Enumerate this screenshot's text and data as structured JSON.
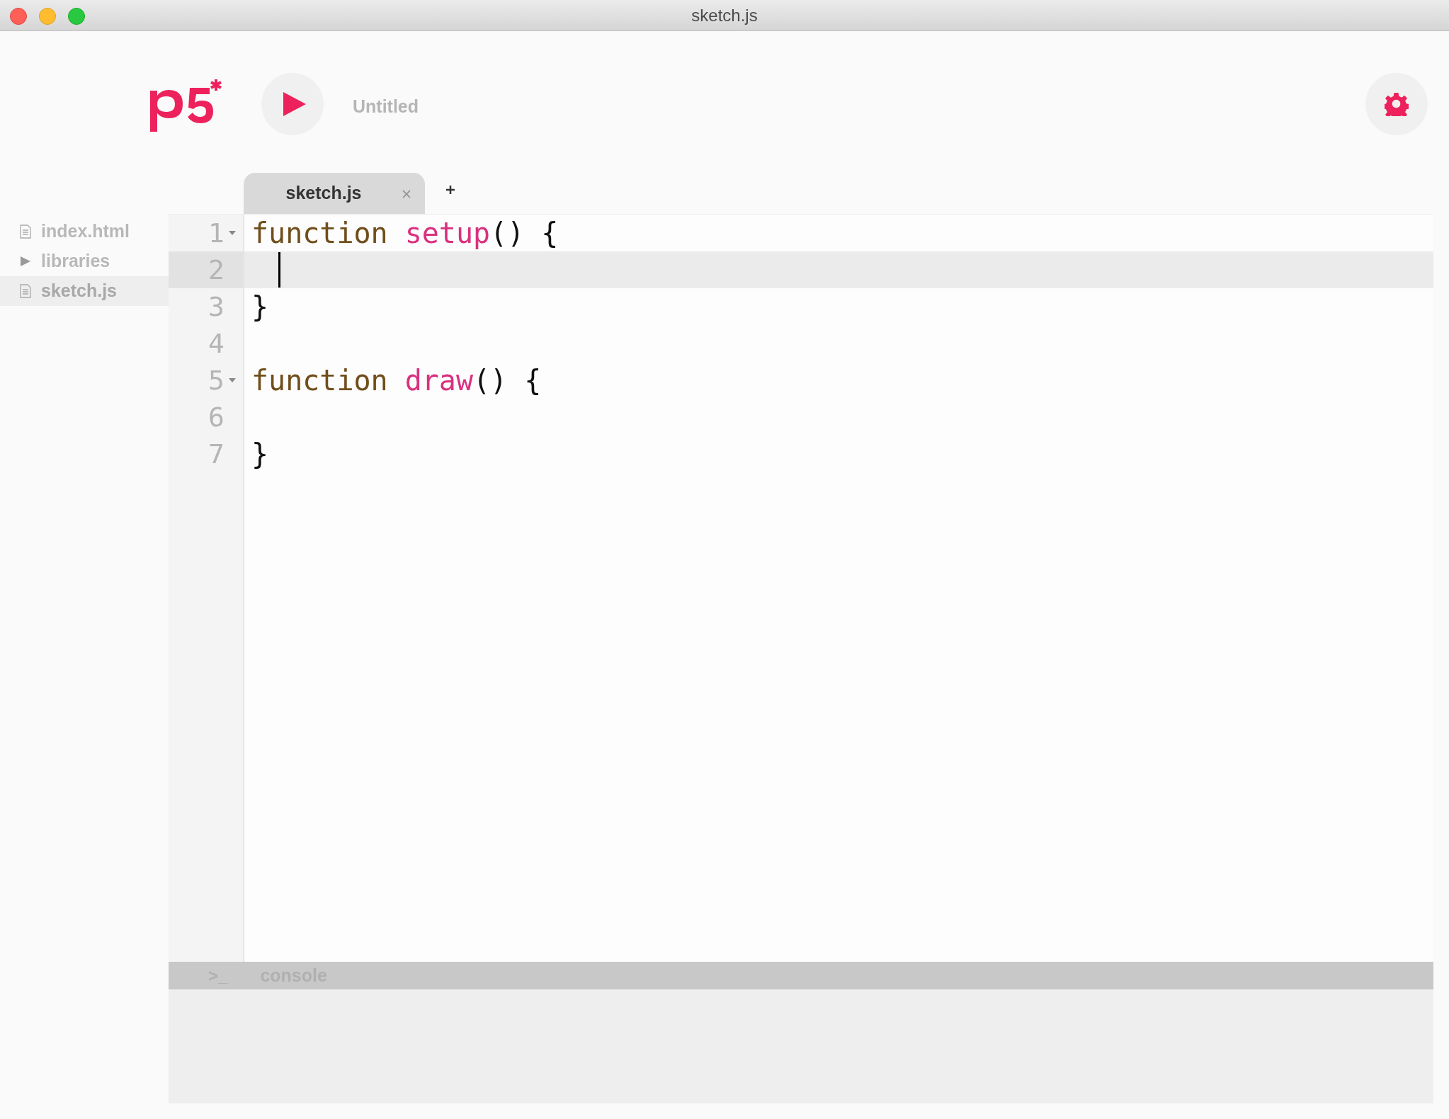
{
  "window": {
    "title": "sketch.js"
  },
  "toolbar": {
    "project_name": "Untitled"
  },
  "tabs": [
    {
      "label": "sketch.js",
      "selected": true,
      "closable": true
    }
  ],
  "sidebar": {
    "items": [
      {
        "label": "index.html",
        "kind": "file",
        "selected": false
      },
      {
        "label": "libraries",
        "kind": "folder",
        "selected": false
      },
      {
        "label": "sketch.js",
        "kind": "file",
        "selected": true
      }
    ]
  },
  "editor": {
    "lines": [
      {
        "number": "1",
        "foldable": true,
        "active": false,
        "cursor": false,
        "tokens": [
          {
            "text": "function",
            "kind": "keyword"
          },
          {
            "text": "setup",
            "kind": "def"
          },
          {
            "text": "() {",
            "kind": "punct"
          }
        ]
      },
      {
        "number": "2",
        "foldable": false,
        "active": true,
        "cursor": true
      },
      {
        "number": "3",
        "foldable": false,
        "active": false,
        "cursor": false,
        "tokens": [
          {
            "text": "}",
            "kind": "punct"
          }
        ]
      },
      {
        "number": "4",
        "foldable": false,
        "active": false,
        "cursor": false
      },
      {
        "number": "5",
        "foldable": true,
        "active": false,
        "cursor": false,
        "tokens": [
          {
            "text": "function",
            "kind": "keyword"
          },
          {
            "text": "draw",
            "kind": "def"
          },
          {
            "text": "() {",
            "kind": "punct"
          }
        ]
      },
      {
        "number": "6",
        "foldable": false,
        "active": false,
        "cursor": false
      },
      {
        "number": "7",
        "foldable": false,
        "active": false,
        "cursor": false,
        "tokens": [
          {
            "text": "}",
            "kind": "punct"
          }
        ]
      }
    ]
  },
  "console": {
    "prompt": ">_",
    "label": "console"
  }
}
